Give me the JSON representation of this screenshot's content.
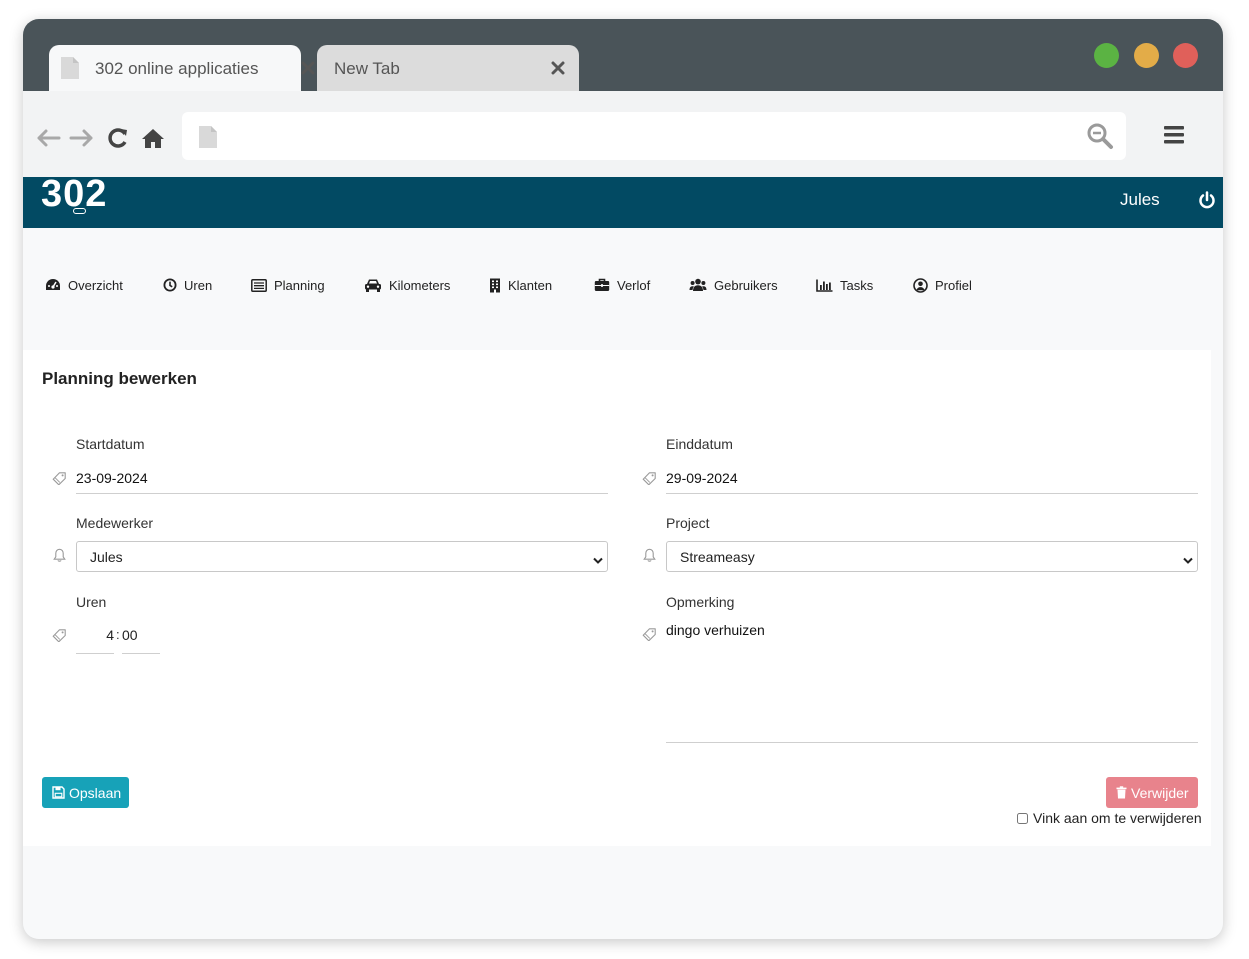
{
  "browser": {
    "tabs": [
      {
        "label": "302 online applicaties"
      },
      {
        "label": "New Tab"
      }
    ],
    "url_value": "",
    "traffic_lights": [
      "#5bb343",
      "#e3ac48",
      "#e0605a"
    ]
  },
  "app": {
    "logo_text": "302",
    "user_name": "Jules",
    "accent_color": "#024a63"
  },
  "nav": {
    "items": [
      {
        "label": "Overzicht",
        "icon": "dashboard-icon"
      },
      {
        "label": "Uren",
        "icon": "clock-icon"
      },
      {
        "label": "Planning",
        "icon": "list-icon"
      },
      {
        "label": "Kilometers",
        "icon": "car-icon"
      },
      {
        "label": "Klanten",
        "icon": "building-icon"
      },
      {
        "label": "Verlof",
        "icon": "briefcase-icon"
      },
      {
        "label": "Gebruikers",
        "icon": "users-icon"
      },
      {
        "label": "Tasks",
        "icon": "bar-chart-icon"
      },
      {
        "label": "Profiel",
        "icon": "user-circle-icon"
      }
    ]
  },
  "form": {
    "title": "Planning bewerken",
    "startdatum": {
      "label": "Startdatum",
      "value": "23-09-2024"
    },
    "einddatum": {
      "label": "Einddatum",
      "value": "29-09-2024"
    },
    "medewerker": {
      "label": "Medewerker",
      "value": "Jules"
    },
    "project": {
      "label": "Project",
      "value": "Streameasy"
    },
    "uren": {
      "label": "Uren",
      "hours": "4",
      "separator": ":",
      "minutes": "00"
    },
    "opmerking": {
      "label": "Opmerking",
      "value": "dingo verhuizen"
    },
    "save_label": "Opslaan",
    "delete_label": "Verwijder",
    "delete_confirm_label": "Vink aan om te verwijderen",
    "save_color": "#17a2b8",
    "delete_color": "#e8838c"
  }
}
